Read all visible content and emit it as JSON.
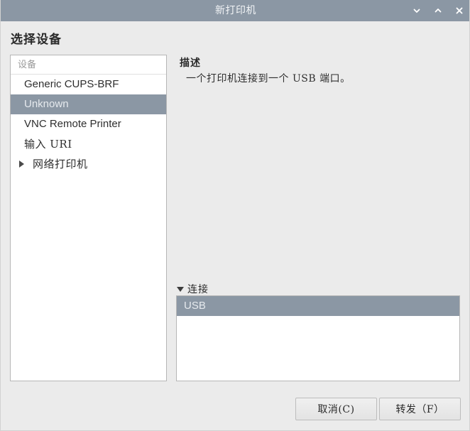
{
  "window": {
    "title": "新打印机",
    "controls": [
      {
        "name": "minimize-icon",
        "glyph": "chevron-down"
      },
      {
        "name": "maximize-icon",
        "glyph": "chevron-up"
      },
      {
        "name": "close-icon",
        "glyph": "x"
      }
    ]
  },
  "page": {
    "heading": "选择设备"
  },
  "devices": {
    "header": "设备",
    "items": [
      {
        "label": "Generic CUPS-BRF",
        "selected": false,
        "expandable": false,
        "cjk": false
      },
      {
        "label": "Unknown",
        "selected": true,
        "expandable": false,
        "cjk": false
      },
      {
        "label": "VNC Remote Printer",
        "selected": false,
        "expandable": false,
        "cjk": false
      },
      {
        "label": "输入 URI",
        "selected": false,
        "expandable": false,
        "cjk": true
      },
      {
        "label": "网络打印机",
        "selected": false,
        "expandable": true,
        "cjk": true
      }
    ]
  },
  "description": {
    "title": "描述",
    "text": "一个打印机连接到一个 USB 端口。"
  },
  "connection": {
    "label": "连接",
    "expanded": true,
    "items": [
      {
        "label": "USB",
        "selected": true
      }
    ]
  },
  "footer": {
    "cancel_label": "取消(C)",
    "forward_label": "转发（F）"
  },
  "colors": {
    "titlebar": "#8b97a4",
    "selection": "#8b97a4",
    "background": "#ebebeb",
    "panel": "#ffffff",
    "border": "#b6b6b6"
  }
}
